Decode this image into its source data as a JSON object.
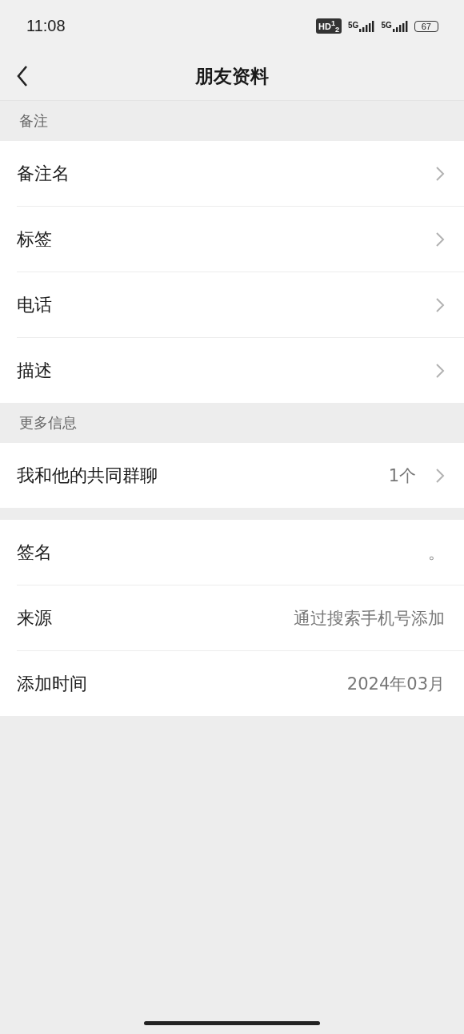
{
  "status_bar": {
    "time": "11:08",
    "hd": "HD$^{1}$$_{2}$",
    "sims": [
      {
        "label": "5G"
      },
      {
        "label": "5G"
      }
    ],
    "battery": "67"
  },
  "header": {
    "title": "朋友资料"
  },
  "sections": [
    {
      "label": "备注",
      "rows": [
        {
          "label": "备注名",
          "chevron": true
        },
        {
          "label": "标签",
          "chevron": true
        },
        {
          "label": "电话",
          "chevron": true
        },
        {
          "label": "描述",
          "chevron": true
        }
      ]
    },
    {
      "label": "更多信息",
      "rows": [
        {
          "label": "我和他的共同群聊",
          "value": "1个",
          "chevron": true
        }
      ]
    },
    {
      "rows": [
        {
          "label": "签名",
          "value": "。"
        },
        {
          "label": "来源",
          "value": "通过搜索手机号添加"
        },
        {
          "label": "添加时间",
          "value": "2024年03月"
        }
      ]
    }
  ]
}
